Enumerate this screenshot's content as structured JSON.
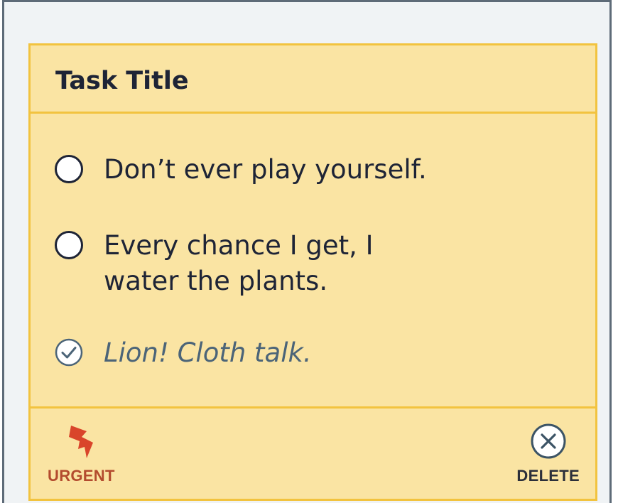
{
  "card": {
    "title": "Task Title",
    "tasks": [
      {
        "text": "Don’t ever play yourself.",
        "completed": false,
        "icon": "radio-empty-icon"
      },
      {
        "text": "Every chance I get, I\nwater the plants.",
        "completed": false,
        "icon": "radio-empty-icon"
      },
      {
        "text": "Lion! Cloth talk.",
        "completed": true,
        "icon": "check-circle-icon"
      }
    ],
    "footer": {
      "urgent_label": "URGENT",
      "urgent_icon": "lightning-icon",
      "delete_label": "DELETE",
      "delete_icon": "close-circle-icon"
    }
  },
  "colors": {
    "card_background": "#fae4a3",
    "card_border": "#f2c33f",
    "frame_background": "#f0f3f5",
    "text_primary": "#1e2436",
    "text_completed": "#4b6478",
    "urgent": "#b34b2e",
    "urgent_icon": "#d9452b",
    "delete_icon": "#3c5466"
  }
}
